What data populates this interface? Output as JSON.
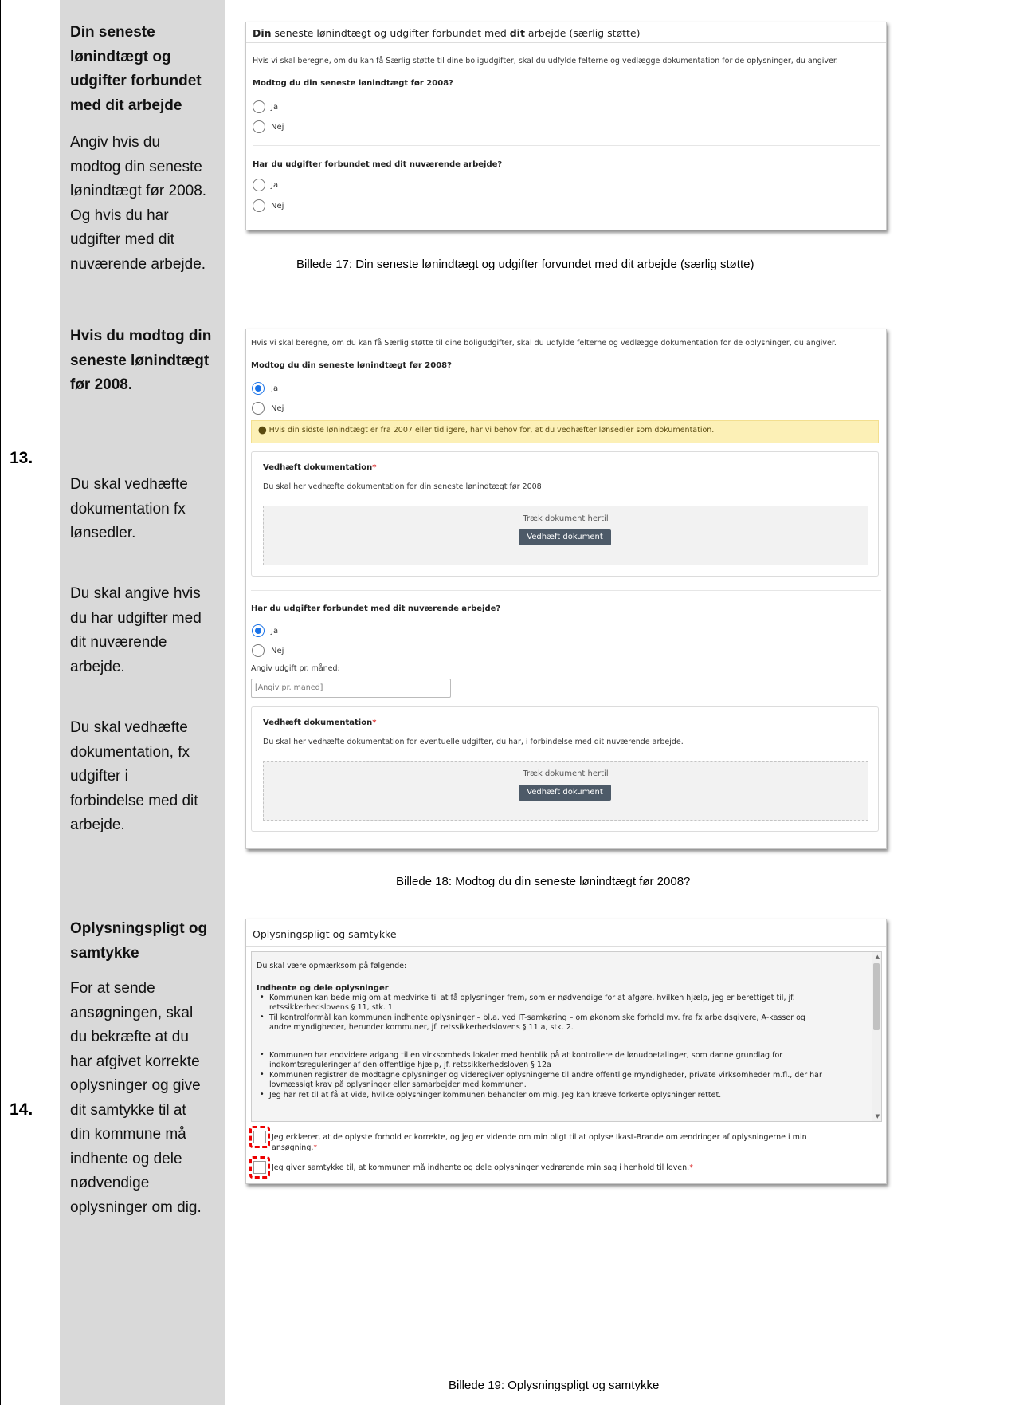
{
  "steps": [
    {
      "number": "13."
    },
    {
      "number": "14."
    }
  ],
  "desc": {
    "s13_title": [
      "Din seneste",
      "lønindtægt og",
      "udgifter forbundet",
      "med dit arbejde"
    ],
    "s13_body": [
      "Angiv hvis du",
      "modtog din seneste",
      "lønindtægt før 2008.",
      "Og hvis du har",
      "udgifter med dit",
      "nuværende arbejde."
    ],
    "s13b_title": [
      "Hvis du modtog din",
      "seneste lønindtægt",
      "før 2008."
    ],
    "s13b_body1": [
      "Du skal vedhæfte",
      "dokumentation fx",
      "lønsedler."
    ],
    "s13b_body2": [
      "Du skal angive hvis",
      "du har udgifter med",
      "dit nuværende",
      "arbejde."
    ],
    "s13b_body3": [
      "Du skal vedhæfte",
      "dokumentation, fx",
      "udgifter i",
      "forbindelse med dit",
      "arbejde."
    ],
    "s14_title": [
      "Oplysningspligt og",
      "samtykke"
    ],
    "s14_body": [
      "For at sende",
      "ansøgningen, skal",
      "du bekræfte at du",
      "har afgivet korrekte",
      "oplysninger og give",
      "dit samtykke til at",
      "din kommune må",
      "indhente og dele",
      "nødvendige",
      "oplysninger om dig."
    ]
  },
  "panel1": {
    "header_b1": "Din",
    "header_t1": " seneste lønindtægt og udgifter forbundet med ",
    "header_b2": "dit",
    "header_t2": " arbejde (særlig støtte)",
    "intro": "Hvis vi skal beregne, om du kan få Særlig støtte til dine boligudgifter, skal du udfylde felterne og vedlægge dokumentation for de oplysninger, du angiver.",
    "q1": "Modtog du din seneste lønindtægt før 2008?",
    "q2": "Har du udgifter forbundet med dit nuværende arbejde?",
    "yes": "Ja",
    "no": "Nej"
  },
  "caption17": "Billede 17: Din seneste lønindtægt og udgifter forvundet med dit arbejde (særlig støtte)",
  "panel2": {
    "intro": "Hvis vi skal beregne, om du kan få Særlig støtte til dine boligudgifter, skal du udfylde felterne og vedlægge dokumentation for de oplysninger, du angiver.",
    "q1": "Modtog du din seneste lønindtægt før 2008?",
    "yes": "Ja",
    "no": "Nej",
    "alert": "Hvis din sidste lønindtægt er fra 2007 eller tidligere, har vi behov for, at du vedhæfter lønsedler som dokumentation.",
    "attach_title": "Vedhæft dokumentation",
    "attach_star": "*",
    "attach1_desc": "Du skal her vedhæfte dokumentation for din seneste lønindtægt før 2008",
    "drop_text": "Træk dokument hertil",
    "attach_button": "Vedhæft dokument",
    "q2": "Har du udgifter forbundet med dit nuværende arbejde?",
    "expense_label": "Angiv udgift pr. måned:",
    "expense_placeholder": "[Angiv pr. maned]",
    "attach2_desc": "Du skal her vedhæfte dokumentation for eventuelle udgifter, du har, i forbindelse med dit nuværende arbejde."
  },
  "caption18": "Billede 18: Modtog du din seneste lønindtægt før 2008?",
  "panel3": {
    "header": "Oplysningspligt og samtykke",
    "notice": "Du skal være opmærksom på følgende:",
    "section": "Indhente og dele oplysninger",
    "b1a": "Kommunen kan bede mig om at medvirke til at få oplysninger frem, som er nødvendige for at afgøre, hvilken hjælp, jeg er berettiget til, jf.",
    "b1b": "retssikkerhedslovens § 11, stk. 1",
    "b2a": "Til kontrolformål kan kommunen indhente oplysninger – bl.a. ved IT-samkøring – om økonomiske forhold mv. fra fx arbejdsgivere, A-kasser og",
    "b2b": "andre myndigheder, herunder kommuner, jf. retssikkerhedslovens § 11 a, stk. 2.",
    "b3a": "Kommunen har endvidere adgang til en virksomheds lokaler med henblik på at kontrollere de lønudbetalinger, som danne grundlag for",
    "b3b": "indkomtsreguleringer af den offentlige hjælp, jf. retssikkerhedsloven § 12a",
    "b4a": "Kommunen registrer de modtagne oplysninger og videregiver oplysningerne til andre offentlige myndigheder, private virksomheder m.fl., der har",
    "b4b": "lovmæssigt krav på oplysninger eller samarbejder med kommunen.",
    "b5": "Jeg har ret til at få at vide, hvilke oplysninger kommunen behandler om mig. Jeg kan kræve forkerte oplysninger rettet.",
    "cb1a": "Jeg erklærer, at de oplyste forhold er korrekte, og jeg er vidende om min pligt til at oplyse Ikast-Brande om ændringer af oplysningerne i min",
    "cb1b": "ansøgning.",
    "cb2": "Jeg giver samtykke til, at kommunen må indhente og dele oplysninger vedrørende min sag i henhold til loven.",
    "star": "*"
  },
  "caption19": "Billede 19: Oplysningspligt og samtykke"
}
